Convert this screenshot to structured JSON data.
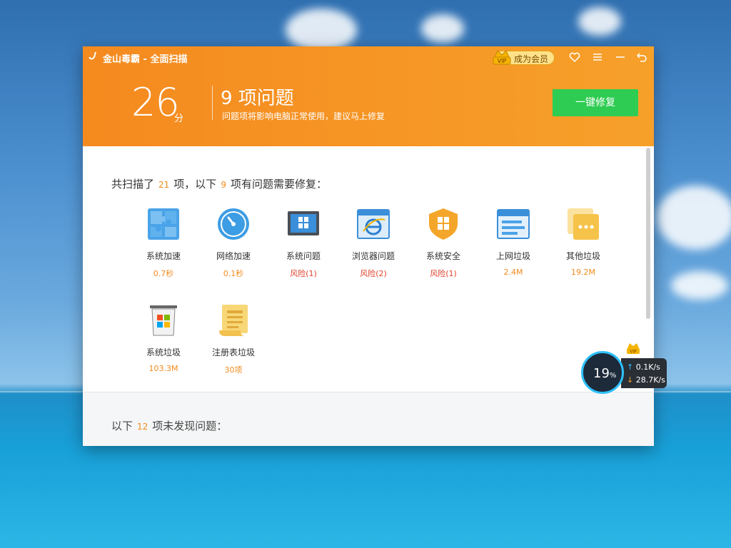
{
  "window": {
    "title": "金山毒霸 - 全面扫描",
    "vip_button_label": "成为会员",
    "vip_badge_text": "VIP"
  },
  "header": {
    "score": "26",
    "score_unit": "分",
    "issues_title": "9 项问题",
    "issues_subtitle": "问题项将影响电脑正常使用，建议马上修复",
    "fix_button_label": "一键修复"
  },
  "summary": {
    "prefix": "共扫描了",
    "scanned_count": "21",
    "middle": "项，以下",
    "problem_count": "9",
    "suffix": "项有问题需要修复："
  },
  "items": [
    {
      "name": "系统加速",
      "value": "0.7秒",
      "icon": "puzzle-icon"
    },
    {
      "name": "网络加速",
      "value": "0.1秒",
      "icon": "speedometer-icon"
    },
    {
      "name": "系统问题",
      "value": "风险(1)",
      "icon": "windows-monitor-icon"
    },
    {
      "name": "浏览器问题",
      "value": "风险(2)",
      "icon": "ie-browser-icon"
    },
    {
      "name": "系统安全",
      "value": "风险(1)",
      "icon": "windows-shield-icon"
    },
    {
      "name": "上网垃圾",
      "value": "2.4M",
      "icon": "browser-window-icon"
    },
    {
      "name": "其他垃圾",
      "value": "19.2M",
      "icon": "folder-dots-icon"
    },
    {
      "name": "系统垃圾",
      "value": "103.3M",
      "icon": "windows-trash-icon"
    },
    {
      "name": "注册表垃圾",
      "value": "30项",
      "icon": "registry-scroll-icon"
    }
  ],
  "footer": {
    "prefix": "以下",
    "count": "12",
    "suffix": "项未发现问题："
  },
  "net_widget": {
    "percent": "19",
    "percent_sign": "%",
    "upload": "0.1K/s",
    "download": "28.7K/s"
  },
  "colors": {
    "header_orange": "#f58a1f",
    "fix_green": "#2ecc52",
    "risk_red": "#e0422a",
    "value_orange": "#f08a1c"
  }
}
